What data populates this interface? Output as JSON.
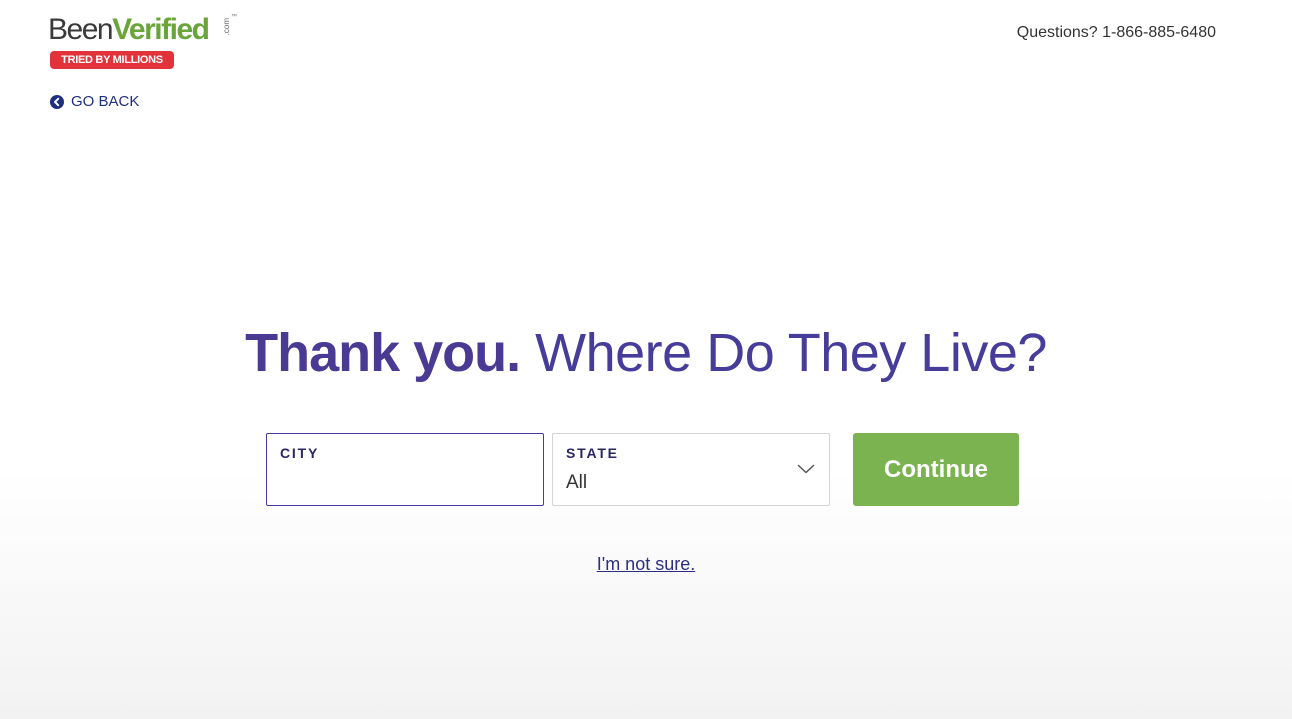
{
  "header": {
    "logo": {
      "been": "Been",
      "verified": "Verified",
      "com": ".com",
      "tm": "™",
      "badge": "TRIED BY MILLIONS"
    },
    "phone": "Questions? 1-866-885-6480"
  },
  "nav": {
    "go_back_label": "GO BACK",
    "go_back_icon": "chevron-left-circle-icon"
  },
  "main": {
    "headline_bold": "Thank you.",
    "headline_light": "Where Do They Live?",
    "city": {
      "label": "CITY",
      "value": "",
      "placeholder": ""
    },
    "state": {
      "label": "STATE",
      "selected": "All",
      "icon": "chevron-down-icon"
    },
    "continue_label": "Continue",
    "not_sure_link": "I'm not sure."
  },
  "colors": {
    "brand_purple": "#4a3aa0",
    "brand_green": "#7ab34f",
    "badge_red": "#e2333b",
    "link_navy": "#1f2f80"
  }
}
